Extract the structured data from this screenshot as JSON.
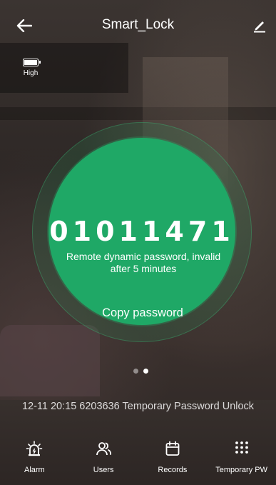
{
  "header": {
    "title": "Smart_Lock",
    "back_icon": "back-arrow-icon",
    "edit_icon": "edit-pencil-icon"
  },
  "battery": {
    "level_label": "High",
    "icon": "battery-icon"
  },
  "password_panel": {
    "code": "01011471",
    "description": "Remote dynamic password, invalid after 5 minutes",
    "copy_label": "Copy password",
    "accent_color": "#1fa866"
  },
  "pager": {
    "total": 2,
    "active_index": 1
  },
  "latest_record": {
    "text": "12-11 20:15  6203636 Temporary Password Unlock"
  },
  "tabs": [
    {
      "label": "Alarm",
      "icon": "alarm-siren-icon"
    },
    {
      "label": "Users",
      "icon": "users-icon"
    },
    {
      "label": "Records",
      "icon": "calendar-records-icon"
    },
    {
      "label": "Temporary PW",
      "icon": "keypad-grid-icon"
    }
  ]
}
